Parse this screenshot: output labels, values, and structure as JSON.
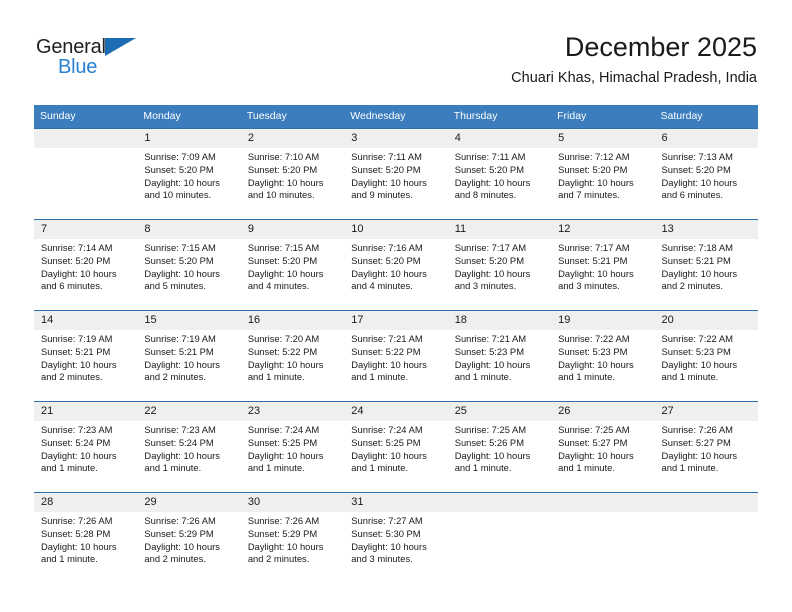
{
  "logo": {
    "part1": "General",
    "part2": "Blue",
    "triangle_color": "#1b6cb3",
    "blue_text_color": "#2980d4"
  },
  "header": {
    "title": "December 2025",
    "subtitle": "Chuari Khas, Himachal Pradesh, India"
  },
  "theme": {
    "header_blue": "#3b7dbd",
    "row_divider_blue": "#2f6fab",
    "daynum_band": "#efefef"
  },
  "weekday_headers": [
    "Sunday",
    "Monday",
    "Tuesday",
    "Wednesday",
    "Thursday",
    "Friday",
    "Saturday"
  ],
  "weeks": [
    {
      "days": [
        {
          "num": "",
          "sunrise": "",
          "sunset": "",
          "daylight1": "",
          "daylight2": ""
        },
        {
          "num": "1",
          "sunrise": "Sunrise: 7:09 AM",
          "sunset": "Sunset: 5:20 PM",
          "daylight1": "Daylight: 10 hours",
          "daylight2": "and 10 minutes."
        },
        {
          "num": "2",
          "sunrise": "Sunrise: 7:10 AM",
          "sunset": "Sunset: 5:20 PM",
          "daylight1": "Daylight: 10 hours",
          "daylight2": "and 10 minutes."
        },
        {
          "num": "3",
          "sunrise": "Sunrise: 7:11 AM",
          "sunset": "Sunset: 5:20 PM",
          "daylight1": "Daylight: 10 hours",
          "daylight2": "and 9 minutes."
        },
        {
          "num": "4",
          "sunrise": "Sunrise: 7:11 AM",
          "sunset": "Sunset: 5:20 PM",
          "daylight1": "Daylight: 10 hours",
          "daylight2": "and 8 minutes."
        },
        {
          "num": "5",
          "sunrise": "Sunrise: 7:12 AM",
          "sunset": "Sunset: 5:20 PM",
          "daylight1": "Daylight: 10 hours",
          "daylight2": "and 7 minutes."
        },
        {
          "num": "6",
          "sunrise": "Sunrise: 7:13 AM",
          "sunset": "Sunset: 5:20 PM",
          "daylight1": "Daylight: 10 hours",
          "daylight2": "and 6 minutes."
        }
      ]
    },
    {
      "days": [
        {
          "num": "7",
          "sunrise": "Sunrise: 7:14 AM",
          "sunset": "Sunset: 5:20 PM",
          "daylight1": "Daylight: 10 hours",
          "daylight2": "and 6 minutes."
        },
        {
          "num": "8",
          "sunrise": "Sunrise: 7:15 AM",
          "sunset": "Sunset: 5:20 PM",
          "daylight1": "Daylight: 10 hours",
          "daylight2": "and 5 minutes."
        },
        {
          "num": "9",
          "sunrise": "Sunrise: 7:15 AM",
          "sunset": "Sunset: 5:20 PM",
          "daylight1": "Daylight: 10 hours",
          "daylight2": "and 4 minutes."
        },
        {
          "num": "10",
          "sunrise": "Sunrise: 7:16 AM",
          "sunset": "Sunset: 5:20 PM",
          "daylight1": "Daylight: 10 hours",
          "daylight2": "and 4 minutes."
        },
        {
          "num": "11",
          "sunrise": "Sunrise: 7:17 AM",
          "sunset": "Sunset: 5:20 PM",
          "daylight1": "Daylight: 10 hours",
          "daylight2": "and 3 minutes."
        },
        {
          "num": "12",
          "sunrise": "Sunrise: 7:17 AM",
          "sunset": "Sunset: 5:21 PM",
          "daylight1": "Daylight: 10 hours",
          "daylight2": "and 3 minutes."
        },
        {
          "num": "13",
          "sunrise": "Sunrise: 7:18 AM",
          "sunset": "Sunset: 5:21 PM",
          "daylight1": "Daylight: 10 hours",
          "daylight2": "and 2 minutes."
        }
      ]
    },
    {
      "days": [
        {
          "num": "14",
          "sunrise": "Sunrise: 7:19 AM",
          "sunset": "Sunset: 5:21 PM",
          "daylight1": "Daylight: 10 hours",
          "daylight2": "and 2 minutes."
        },
        {
          "num": "15",
          "sunrise": "Sunrise: 7:19 AM",
          "sunset": "Sunset: 5:21 PM",
          "daylight1": "Daylight: 10 hours",
          "daylight2": "and 2 minutes."
        },
        {
          "num": "16",
          "sunrise": "Sunrise: 7:20 AM",
          "sunset": "Sunset: 5:22 PM",
          "daylight1": "Daylight: 10 hours",
          "daylight2": "and 1 minute."
        },
        {
          "num": "17",
          "sunrise": "Sunrise: 7:21 AM",
          "sunset": "Sunset: 5:22 PM",
          "daylight1": "Daylight: 10 hours",
          "daylight2": "and 1 minute."
        },
        {
          "num": "18",
          "sunrise": "Sunrise: 7:21 AM",
          "sunset": "Sunset: 5:23 PM",
          "daylight1": "Daylight: 10 hours",
          "daylight2": "and 1 minute."
        },
        {
          "num": "19",
          "sunrise": "Sunrise: 7:22 AM",
          "sunset": "Sunset: 5:23 PM",
          "daylight1": "Daylight: 10 hours",
          "daylight2": "and 1 minute."
        },
        {
          "num": "20",
          "sunrise": "Sunrise: 7:22 AM",
          "sunset": "Sunset: 5:23 PM",
          "daylight1": "Daylight: 10 hours",
          "daylight2": "and 1 minute."
        }
      ]
    },
    {
      "days": [
        {
          "num": "21",
          "sunrise": "Sunrise: 7:23 AM",
          "sunset": "Sunset: 5:24 PM",
          "daylight1": "Daylight: 10 hours",
          "daylight2": "and 1 minute."
        },
        {
          "num": "22",
          "sunrise": "Sunrise: 7:23 AM",
          "sunset": "Sunset: 5:24 PM",
          "daylight1": "Daylight: 10 hours",
          "daylight2": "and 1 minute."
        },
        {
          "num": "23",
          "sunrise": "Sunrise: 7:24 AM",
          "sunset": "Sunset: 5:25 PM",
          "daylight1": "Daylight: 10 hours",
          "daylight2": "and 1 minute."
        },
        {
          "num": "24",
          "sunrise": "Sunrise: 7:24 AM",
          "sunset": "Sunset: 5:25 PM",
          "daylight1": "Daylight: 10 hours",
          "daylight2": "and 1 minute."
        },
        {
          "num": "25",
          "sunrise": "Sunrise: 7:25 AM",
          "sunset": "Sunset: 5:26 PM",
          "daylight1": "Daylight: 10 hours",
          "daylight2": "and 1 minute."
        },
        {
          "num": "26",
          "sunrise": "Sunrise: 7:25 AM",
          "sunset": "Sunset: 5:27 PM",
          "daylight1": "Daylight: 10 hours",
          "daylight2": "and 1 minute."
        },
        {
          "num": "27",
          "sunrise": "Sunrise: 7:26 AM",
          "sunset": "Sunset: 5:27 PM",
          "daylight1": "Daylight: 10 hours",
          "daylight2": "and 1 minute."
        }
      ]
    },
    {
      "days": [
        {
          "num": "28",
          "sunrise": "Sunrise: 7:26 AM",
          "sunset": "Sunset: 5:28 PM",
          "daylight1": "Daylight: 10 hours",
          "daylight2": "and 1 minute."
        },
        {
          "num": "29",
          "sunrise": "Sunrise: 7:26 AM",
          "sunset": "Sunset: 5:29 PM",
          "daylight1": "Daylight: 10 hours",
          "daylight2": "and 2 minutes."
        },
        {
          "num": "30",
          "sunrise": "Sunrise: 7:26 AM",
          "sunset": "Sunset: 5:29 PM",
          "daylight1": "Daylight: 10 hours",
          "daylight2": "and 2 minutes."
        },
        {
          "num": "31",
          "sunrise": "Sunrise: 7:27 AM",
          "sunset": "Sunset: 5:30 PM",
          "daylight1": "Daylight: 10 hours",
          "daylight2": "and 3 minutes."
        },
        {
          "num": "",
          "sunrise": "",
          "sunset": "",
          "daylight1": "",
          "daylight2": ""
        },
        {
          "num": "",
          "sunrise": "",
          "sunset": "",
          "daylight1": "",
          "daylight2": ""
        },
        {
          "num": "",
          "sunrise": "",
          "sunset": "",
          "daylight1": "",
          "daylight2": ""
        }
      ]
    }
  ]
}
